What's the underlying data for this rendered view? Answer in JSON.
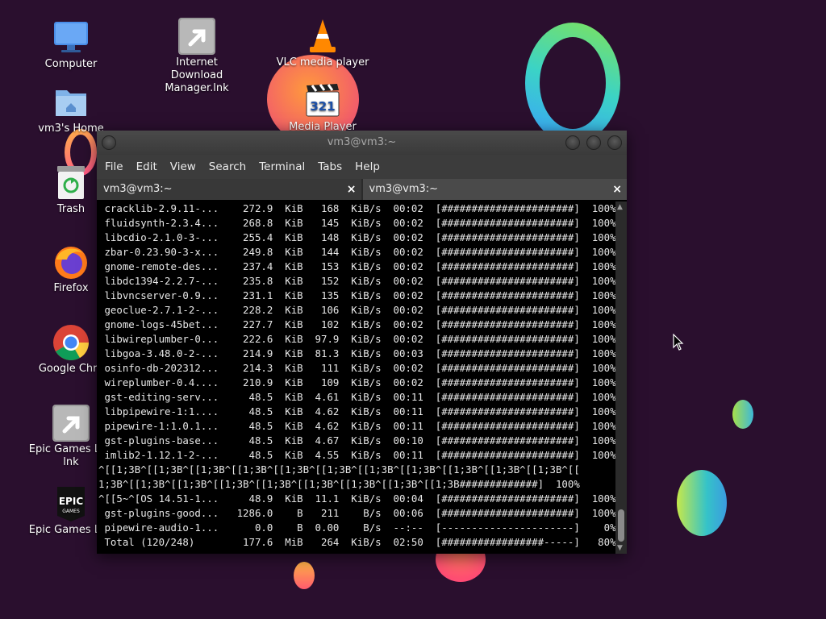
{
  "desktop": {
    "icons": [
      {
        "name": "Computer",
        "label": "Computer"
      },
      {
        "name": "Internet Download Manager",
        "label": "Internet Download Manager.lnk"
      },
      {
        "name": "VLC",
        "label": "VLC media player"
      },
      {
        "name": "Home",
        "label": "vm3's Home"
      },
      {
        "name": "MPC",
        "label": "Media Player Classic"
      },
      {
        "name": "Trash",
        "label": "Trash"
      },
      {
        "name": "Firefox",
        "label": "Firefox"
      },
      {
        "name": "Chrome",
        "label": "Google Chro"
      },
      {
        "name": "Epic Launcher Link",
        "label": "Epic Games Lau lnk"
      },
      {
        "name": "Epic Games",
        "label": "Epic Games Lau"
      }
    ],
    "epic_logo_text": "EPIC GAMES",
    "mpc_icon_text": "321"
  },
  "terminal": {
    "title": "vm3@vm3:~",
    "menu": [
      "File",
      "Edit",
      "View",
      "Search",
      "Terminal",
      "Tabs",
      "Help"
    ],
    "tabs": [
      {
        "label": "vm3@vm3:~",
        "close": "×"
      },
      {
        "label": "vm3@vm3:~",
        "close": "×"
      }
    ],
    "lines": [
      " cracklib-2.9.11-...    272.9  KiB   168  KiB/s  00:02  [######################]  100%",
      " fluidsynth-2.3.4...    268.8  KiB   145  KiB/s  00:02  [######################]  100%",
      " libcdio-2.1.0-3-...    255.4  KiB   148  KiB/s  00:02  [######################]  100%",
      " zbar-0.23.90-3-x...    249.8  KiB   144  KiB/s  00:02  [######################]  100%",
      " gnome-remote-des...    237.4  KiB   153  KiB/s  00:02  [######################]  100%",
      " libdc1394-2.2.7-...    235.8  KiB   152  KiB/s  00:02  [######################]  100%",
      " libvncserver-0.9...    231.1  KiB   135  KiB/s  00:02  [######################]  100%",
      " geoclue-2.7.1-2-...    228.2  KiB   106  KiB/s  00:02  [######################]  100%",
      " gnome-logs-45bet...    227.7  KiB   102  KiB/s  00:02  [######################]  100%",
      " libwireplumber-0...    222.6  KiB  97.9  KiB/s  00:02  [######################]  100%",
      " libgoa-3.48.0-2-...    214.9  KiB  81.3  KiB/s  00:03  [######################]  100%",
      " osinfo-db-202312...    214.3  KiB   111  KiB/s  00:02  [######################]  100%",
      " wireplumber-0.4....    210.9  KiB   109  KiB/s  00:02  [######################]  100%",
      " gst-editing-serv...     48.5  KiB  4.61  KiB/s  00:11  [######################]  100%",
      " libpipewire-1:1....     48.5  KiB  4.62  KiB/s  00:11  [######################]  100%",
      " pipewire-1:1.0.1...     48.5  KiB  4.62  KiB/s  00:11  [######################]  100%",
      " gst-plugins-base...     48.5  KiB  4.67  KiB/s  00:10  [######################]  100%",
      " imlib2-1.12.1-2-...     48.5  KiB  4.55  KiB/s  00:11  [######################]  100%",
      "^[[1;3B^[[1;3B^[[1;3B^[[1;3B^[[1;3B^[[1;3B^[[1;3B^[[1;3B^[[1;3B^[[1;3B^[[1;3B^[[",
      "1;3B^[[1;3B^[[1;3B^[[1;3B^[[1;3B^[[1;3B^[[1;3B^[[1;3B^[[1;3B#############]  100%",
      "^[[5~^[OS 14.51-1...     48.9  KiB  11.1  KiB/s  00:04  [######################]  100%",
      " gst-plugins-good...   1286.0    B   211    B/s  00:06  [######################]  100%",
      " pipewire-audio-1...      0.0    B  0.00    B/s  --:--  [----------------------]    0%",
      " Total (120/248)        177.6  MiB   264  KiB/s  02:50  [#################-----]   80%"
    ],
    "scroll_up": "▲",
    "scroll_down": "▼"
  }
}
